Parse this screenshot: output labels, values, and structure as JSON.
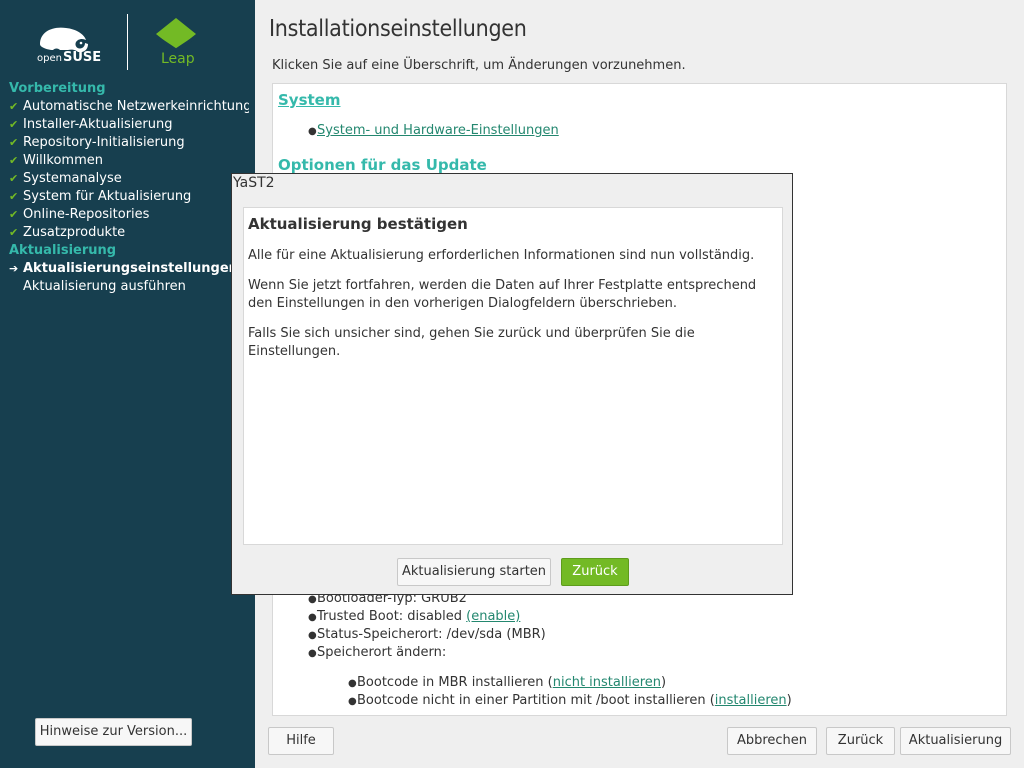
{
  "sidebar": {
    "logo_brand": "openSUSE",
    "logo_product": "Leap",
    "sections": [
      {
        "heading": "Vorbereitung",
        "steps": [
          {
            "label": "Automatische Netzwerkeinrichtung",
            "state": "done"
          },
          {
            "label": "Installer-Aktualisierung",
            "state": "done"
          },
          {
            "label": "Repository-Initialisierung",
            "state": "done"
          },
          {
            "label": "Willkommen",
            "state": "done"
          },
          {
            "label": "Systemanalyse",
            "state": "done"
          },
          {
            "label": "System für Aktualisierung",
            "state": "done"
          },
          {
            "label": "Online-Repositories",
            "state": "done"
          },
          {
            "label": "Zusatzprodukte",
            "state": "done"
          }
        ]
      },
      {
        "heading": "Aktualisierung",
        "steps": [
          {
            "label": "Aktualisierungseinstellungen",
            "state": "current"
          },
          {
            "label": "Aktualisierung ausführen",
            "state": "pending"
          }
        ]
      }
    ],
    "release_notes_button": "Hinweise zur Version..."
  },
  "main": {
    "title": "Installationseinstellungen",
    "subtitle": "Klicken Sie auf eine Überschrift, um Änderungen vorzunehmen.",
    "system_heading": "System",
    "system_link": "System- und Hardware-Einstellungen",
    "update_options_heading": "Optionen für das Update",
    "bootloader_type": "Bootloader-Typ: GRUB2",
    "trusted_boot_prefix": "Trusted Boot: disabled ",
    "trusted_boot_link": "(enable)",
    "status_location": "Status-Speicherort: /dev/sda (MBR)",
    "change_location": "Speicherort ändern:",
    "mbr_prefix": "Bootcode in MBR installieren (",
    "mbr_link": "nicht installieren",
    "mbr_suffix": ")",
    "partition_prefix": "Bootcode nicht in einer Partition mit /boot installieren (",
    "partition_link": "installieren",
    "partition_suffix": ")"
  },
  "footer": {
    "help": "Hilfe",
    "abort": "Abbrechen",
    "back": "Zurück",
    "update": "Aktualisierung"
  },
  "dialog": {
    "window_title": "YaST2",
    "heading": "Aktualisierung bestätigen",
    "para1": "Alle für eine Aktualisierung erforderlichen Informationen sind nun vollständig.",
    "para2": "Wenn Sie jetzt fortfahren, werden die Daten auf Ihrer Festplatte entsprechend den Einstellungen in den vorherigen Dialogfeldern überschrieben.",
    "para3": "Falls Sie sich unsicher sind, gehen Sie zurück und überprüfen Sie die Einstellungen.",
    "start_button": "Aktualisierung starten",
    "back_button": "Zurück"
  },
  "colors": {
    "sidebar_bg": "#173f4f",
    "accent_teal": "#35b9ab",
    "brand_green": "#73ba25",
    "link": "#23876f"
  }
}
